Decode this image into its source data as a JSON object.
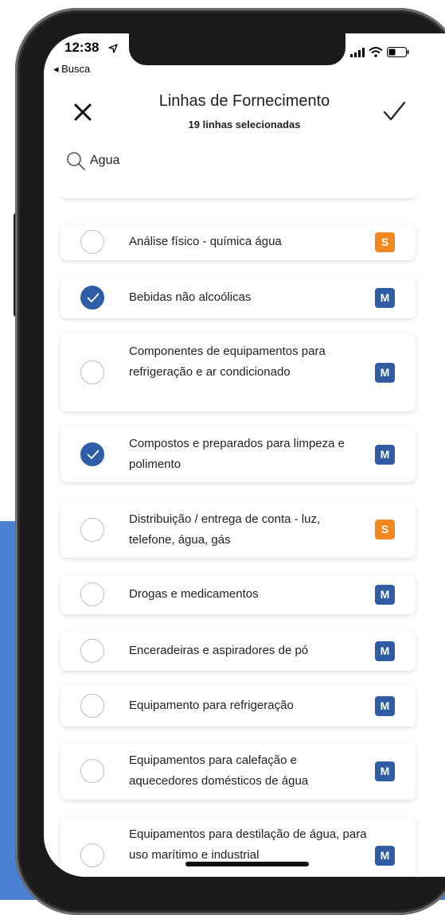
{
  "status_bar": {
    "time": "12:38",
    "back_label": "◂ Busca"
  },
  "header": {
    "title": "Linhas de Fornecimento",
    "subtitle": "19 linhas selecionadas"
  },
  "search": {
    "value": "Agua"
  },
  "colors": {
    "background_accent": "#4a7fd2",
    "checked": "#2f5da6",
    "badge_m": "#2f5ca3",
    "badge_s": "#f0881f"
  },
  "items": [
    {
      "label": "Análise físico - química água",
      "checked": false,
      "badge": "S"
    },
    {
      "label": "Bebidas não alcoólicas",
      "checked": true,
      "badge": "M"
    },
    {
      "label": "Componentes de equipamentos para refrigeração e ar condicionado",
      "checked": false,
      "badge": "M"
    },
    {
      "label": "Compostos e preparados para limpeza e polimento",
      "checked": true,
      "badge": "M"
    },
    {
      "label": "Distribuição / entrega de conta - luz, telefone, água, gás",
      "checked": false,
      "badge": "S"
    },
    {
      "label": "Drogas e medicamentos",
      "checked": false,
      "badge": "M"
    },
    {
      "label": "Enceradeiras e aspiradores de pó",
      "checked": false,
      "badge": "M"
    },
    {
      "label": "Equipamento para refrigeração",
      "checked": false,
      "badge": "M"
    },
    {
      "label": "Equipamentos para calefação e aquecedores domésticos de água",
      "checked": false,
      "badge": "M"
    },
    {
      "label": "Equipamentos para destilação de água, para uso marítimo e industrial",
      "checked": false,
      "badge": "M"
    }
  ]
}
